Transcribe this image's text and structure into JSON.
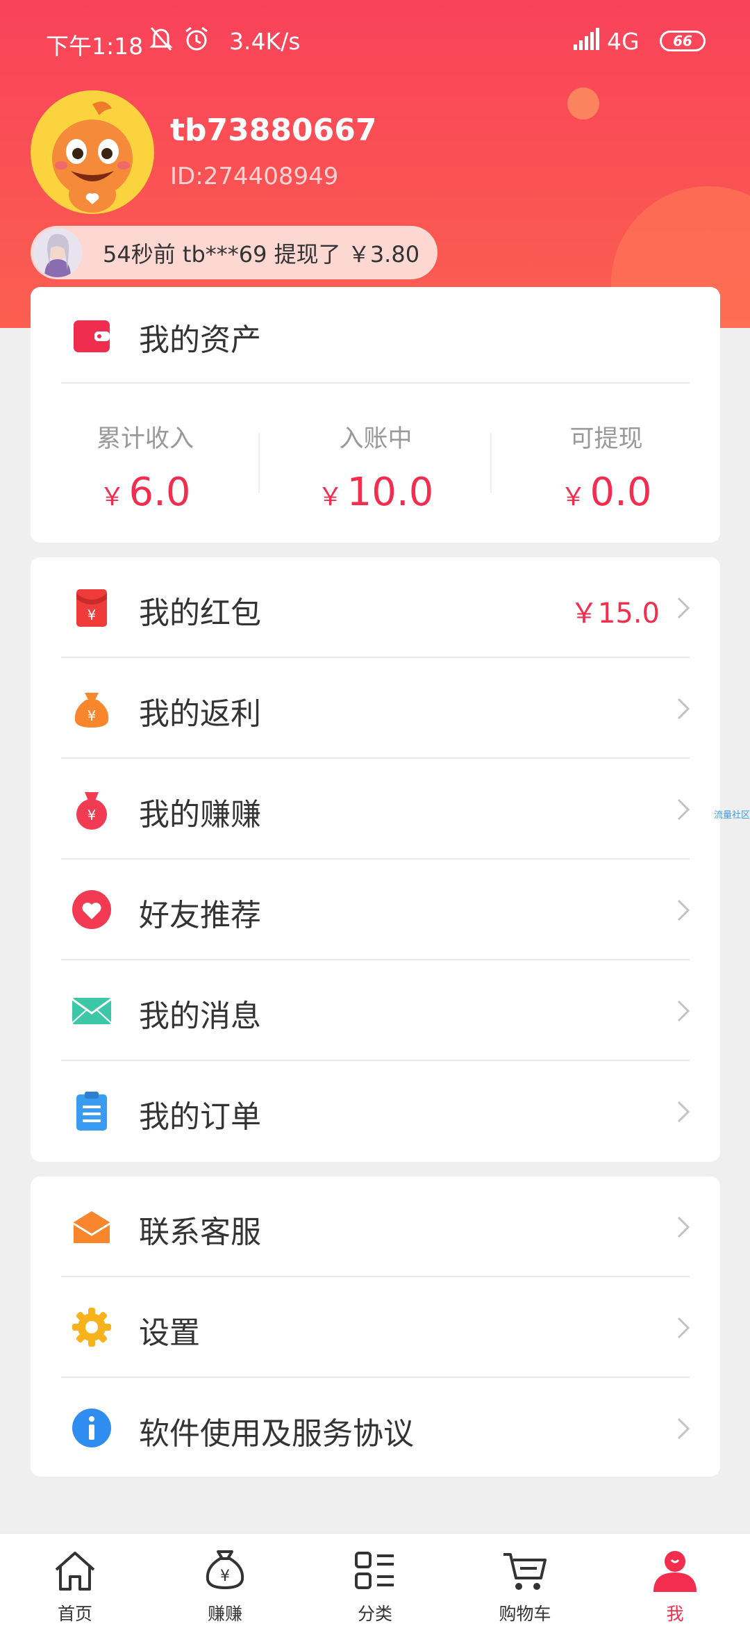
{
  "status_bar": {
    "time": "下午1:18",
    "speed": "3.4K/s",
    "network": "4G",
    "battery": "66"
  },
  "user": {
    "name": "tb73880667",
    "id_label": "ID:274408949"
  },
  "ticker": {
    "text": "54秒前 tb***69 提现了 ￥3.80"
  },
  "assets": {
    "title": "我的资产",
    "stats": [
      {
        "label": "累计收入",
        "currency": "￥",
        "value": "6.0"
      },
      {
        "label": "入账中",
        "currency": "￥",
        "value": "10.0"
      },
      {
        "label": "可提现",
        "currency": "￥",
        "value": "0.0"
      }
    ]
  },
  "menu1": [
    {
      "label": "我的红包",
      "value": "￥15.0",
      "icon": "red-envelope-icon"
    },
    {
      "label": "我的返利",
      "value": "",
      "icon": "money-bag-icon"
    },
    {
      "label": "我的赚赚",
      "value": "",
      "icon": "earn-bag-icon"
    },
    {
      "label": "好友推荐",
      "value": "",
      "icon": "heart-icon"
    },
    {
      "label": "我的消息",
      "value": "",
      "icon": "envelope-icon"
    },
    {
      "label": "我的订单",
      "value": "",
      "icon": "clipboard-icon"
    }
  ],
  "menu2": [
    {
      "label": "联系客服",
      "icon": "service-mail-icon"
    },
    {
      "label": "设置",
      "icon": "gear-icon"
    },
    {
      "label": "软件使用及服务协议",
      "icon": "info-icon"
    }
  ],
  "side_label": "流量社区",
  "tabs": [
    {
      "label": "首页",
      "icon": "home-icon"
    },
    {
      "label": "赚赚",
      "icon": "money-bag-icon"
    },
    {
      "label": "分类",
      "icon": "category-icon"
    },
    {
      "label": "购物车",
      "icon": "cart-icon"
    },
    {
      "label": "我",
      "icon": "profile-icon",
      "active": true
    }
  ],
  "colors": {
    "accent": "#f22d4e",
    "header_start": "#f9425a",
    "header_end": "#fb5f4f"
  }
}
